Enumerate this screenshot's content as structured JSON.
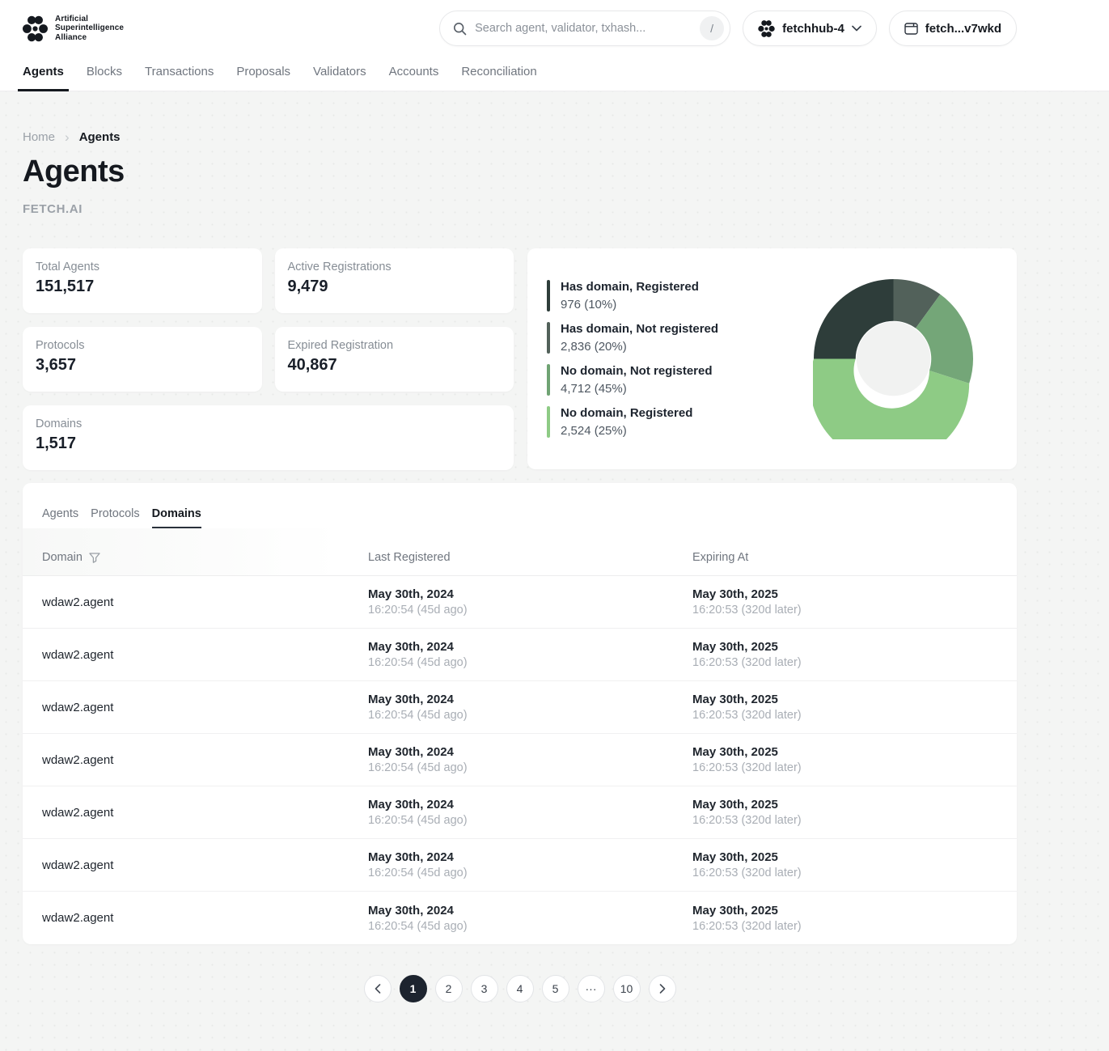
{
  "brand": {
    "name_lines": [
      "Artificial",
      "Superintelligence",
      "Alliance"
    ]
  },
  "header": {
    "search": {
      "placeholder": "Search agent, validator, txhash...",
      "shortcut": "/"
    },
    "network": {
      "label": "fetchhub-4"
    },
    "wallet": {
      "label": "fetch...v7wkd"
    }
  },
  "nav": {
    "items": [
      {
        "label": "Agents",
        "active": true
      },
      {
        "label": "Blocks"
      },
      {
        "label": "Transactions"
      },
      {
        "label": "Proposals"
      },
      {
        "label": "Validators"
      },
      {
        "label": "Accounts"
      },
      {
        "label": "Reconciliation"
      }
    ]
  },
  "breadcrumb": {
    "home": "Home",
    "current": "Agents"
  },
  "page": {
    "title": "Agents",
    "subtitle": "FETCH.AI"
  },
  "stats": {
    "cards": [
      {
        "label": "Total Agents",
        "value": "151,517"
      },
      {
        "label": "Active Registrations",
        "value": "9,479"
      },
      {
        "label": "Protocols",
        "value": "3,657"
      },
      {
        "label": "Expired Registration",
        "value": "40,867"
      },
      {
        "label": "Domains",
        "value": "1,517"
      }
    ]
  },
  "chart_data": {
    "type": "pie",
    "subtype": "donut",
    "title": "",
    "labels": [
      "Has domain, Registered",
      "Has domain, Not registered",
      "No domain, Not registered",
      "No domain, Registered"
    ],
    "values": [
      976,
      2836,
      4712,
      2524
    ],
    "value_labels": [
      "976 (10%)",
      "2,836 (20%)",
      "4,712 (45%)",
      "2,524 (25%)"
    ],
    "percents": [
      10,
      20,
      45,
      25
    ],
    "legend_position": "left",
    "legend_colors": [
      "#2e3d3a",
      "#52615a",
      "#6fa373",
      "#8ecb85"
    ],
    "slice_percents_clockwise_from_top": [
      10,
      20,
      45,
      25
    ],
    "slice_colors_clockwise_from_top": [
      "#52615a",
      "#74a678",
      "#8ecb85",
      "#2e3d3a"
    ],
    "donut_hole_color": "#f1f2f1"
  },
  "tabs": {
    "items": [
      {
        "label": "Agents"
      },
      {
        "label": "Protocols"
      },
      {
        "label": "Domains",
        "active": true
      }
    ]
  },
  "table": {
    "columns": [
      "Domain",
      "Last Registered",
      "Expiring At"
    ],
    "rows": [
      {
        "domain": "wdaw2.agent",
        "registered_date": "May 30th, 2024",
        "registered_time": "16:20:54 (45d ago)",
        "expiring_date": "May 30th, 2025",
        "expiring_time": "16:20:53 (320d later)"
      },
      {
        "domain": "wdaw2.agent",
        "registered_date": "May 30th, 2024",
        "registered_time": "16:20:54 (45d ago)",
        "expiring_date": "May 30th, 2025",
        "expiring_time": "16:20:53 (320d later)"
      },
      {
        "domain": "wdaw2.agent",
        "registered_date": "May 30th, 2024",
        "registered_time": "16:20:54 (45d ago)",
        "expiring_date": "May 30th, 2025",
        "expiring_time": "16:20:53 (320d later)"
      },
      {
        "domain": "wdaw2.agent",
        "registered_date": "May 30th, 2024",
        "registered_time": "16:20:54 (45d ago)",
        "expiring_date": "May 30th, 2025",
        "expiring_time": "16:20:53 (320d later)"
      },
      {
        "domain": "wdaw2.agent",
        "registered_date": "May 30th, 2024",
        "registered_time": "16:20:54 (45d ago)",
        "expiring_date": "May 30th, 2025",
        "expiring_time": "16:20:53 (320d later)"
      },
      {
        "domain": "wdaw2.agent",
        "registered_date": "May 30th, 2024",
        "registered_time": "16:20:54 (45d ago)",
        "expiring_date": "May 30th, 2025",
        "expiring_time": "16:20:53 (320d later)"
      },
      {
        "domain": "wdaw2.agent",
        "registered_date": "May 30th, 2024",
        "registered_time": "16:20:54 (45d ago)",
        "expiring_date": "May 30th, 2025",
        "expiring_time": "16:20:53 (320d later)"
      }
    ]
  },
  "pagination": {
    "pages": [
      {
        "label": "1",
        "active": true
      },
      {
        "label": "2"
      },
      {
        "label": "3"
      },
      {
        "label": "4"
      },
      {
        "label": "5"
      },
      {
        "label": "···"
      },
      {
        "label": "10"
      }
    ]
  },
  "colors": {
    "accent_dark": "#1d242f",
    "page_background": "#f4f5f4",
    "card_background": "#ffffff"
  }
}
